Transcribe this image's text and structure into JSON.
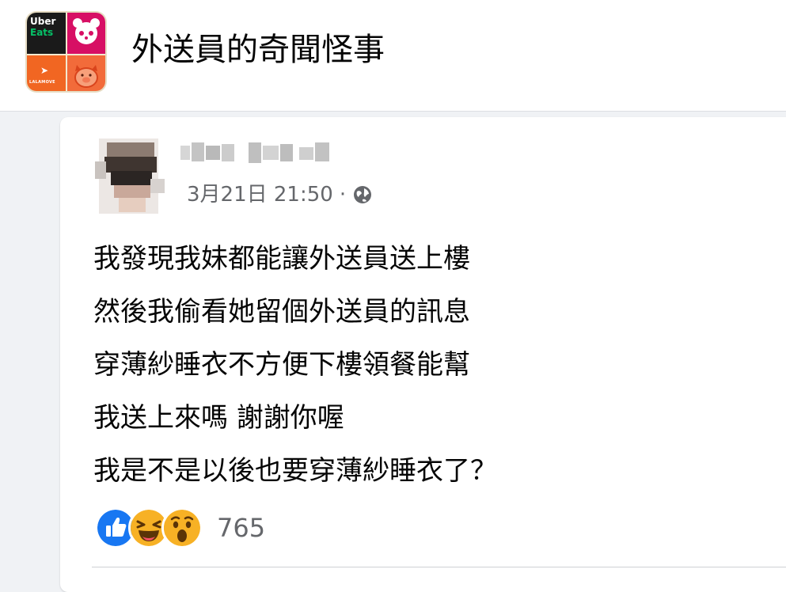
{
  "group": {
    "title": "外送員的奇聞怪事",
    "logo_tiles": {
      "uber_line1": "Uber",
      "uber_line2": "Eats",
      "lalamove": "LALAMOVE"
    }
  },
  "post": {
    "timestamp": "3月21日 21:50",
    "separator": "·",
    "privacy_icon": "globe-icon",
    "lines": [
      "我發現我妹都能讓外送員送上樓",
      "然後我偷看她留個外送員的訊息",
      "穿薄紗睡衣不方便下樓領餐能幫",
      "我送上來嗎 謝謝你喔",
      "我是不是以後也要穿薄紗睡衣了？"
    ],
    "reactions": {
      "icons": [
        "like-icon",
        "haha-icon",
        "wow-icon"
      ],
      "count": "765"
    }
  },
  "colors": {
    "like": "#1877f2",
    "reaction_yellow": "#f7b125",
    "meta_text": "#65676b",
    "foodpanda": "#d70f64",
    "lalamove": "#f16622"
  }
}
